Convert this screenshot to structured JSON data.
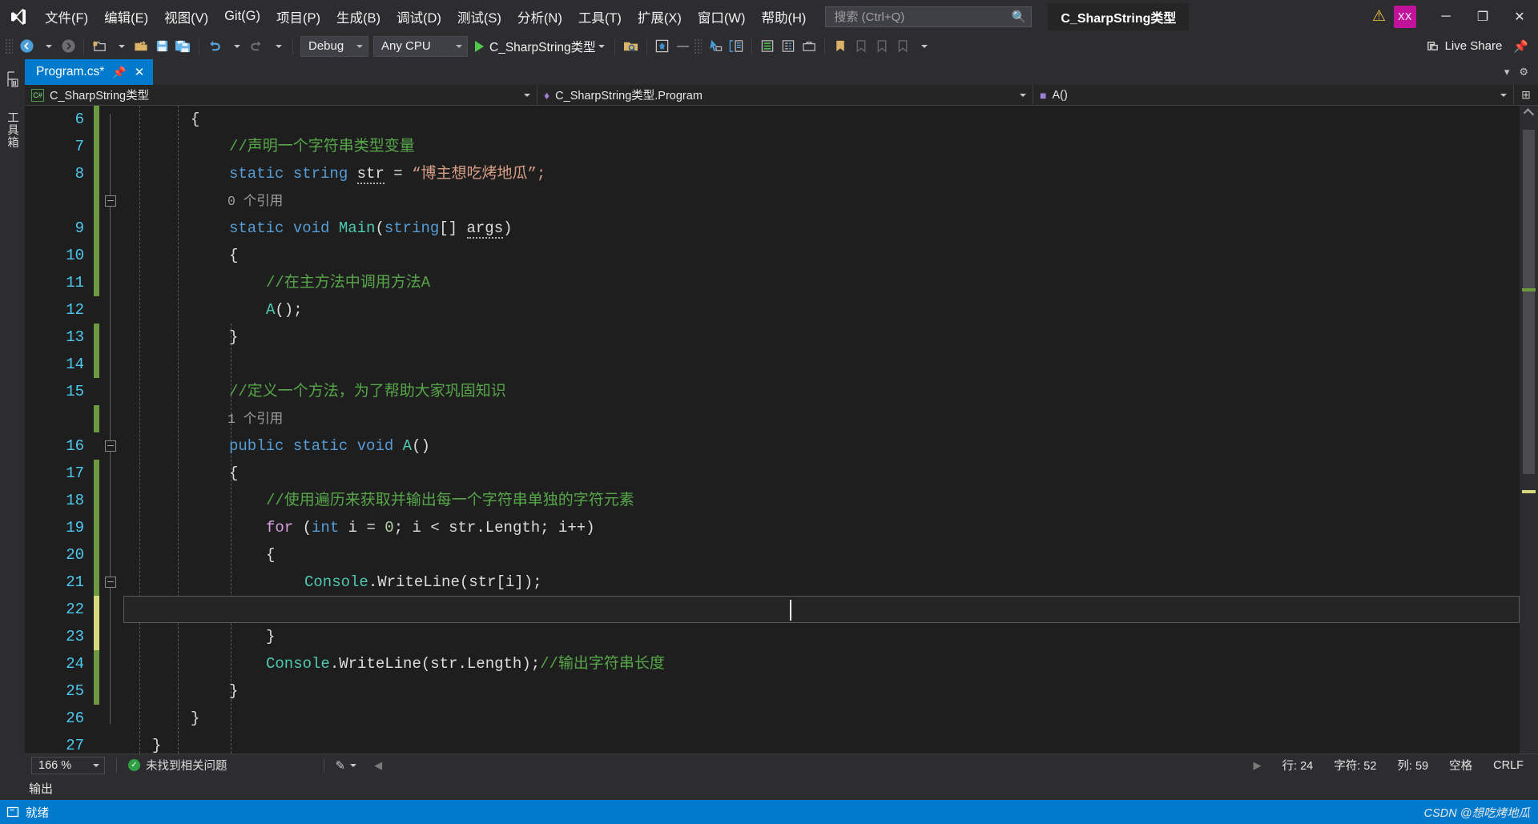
{
  "titlebar": {
    "logo_icon": "visual-studio-logo-icon",
    "menus": [
      {
        "label": "文件(F)",
        "accel": "F"
      },
      {
        "label": "编辑(E)",
        "accel": "E"
      },
      {
        "label": "视图(V)",
        "accel": "V"
      },
      {
        "label": "Git(G)",
        "accel": "G"
      },
      {
        "label": "项目(P)",
        "accel": "P"
      },
      {
        "label": "生成(B)",
        "accel": "B"
      },
      {
        "label": "调试(D)",
        "accel": "D"
      },
      {
        "label": "测试(S)",
        "accel": "S"
      },
      {
        "label": "分析(N)",
        "accel": "N"
      },
      {
        "label": "工具(T)",
        "accel": "T"
      },
      {
        "label": "扩展(X)",
        "accel": "X"
      },
      {
        "label": "窗口(W)",
        "accel": "W"
      },
      {
        "label": "帮助(H)",
        "accel": "H"
      }
    ],
    "search": {
      "placeholder": "搜索 (Ctrl+Q)",
      "value": "",
      "icon": "search-icon"
    },
    "project_name": "C_SharpString类型",
    "warning_icon": "warning-triangle-icon",
    "avatar_initials": "XX",
    "avatar_color": "#c1129a",
    "window_buttons": {
      "minimize": "─",
      "maximize": "❐",
      "close": "✕"
    }
  },
  "toolbar": {
    "nav_back_icon": "navigate-back-icon",
    "nav_forward_icon": "navigate-forward-icon",
    "new_project_icon": "new-project-icon",
    "open_icon": "open-file-icon",
    "save_icon": "save-icon",
    "save_all_icon": "save-all-icon",
    "undo_icon": "undo-icon",
    "redo_icon": "redo-icon",
    "config_value": "Debug",
    "platform_value": "Any CPU",
    "run_label": "C_SharpString类型",
    "run_icon": "play-icon",
    "find_in_files_icon": "find-in-files-icon",
    "home_icon": "home-window-icon",
    "pointer_icon": "pointer-select-icon",
    "compare_icon": "compare-files-icon",
    "properties_icon": "properties-icon",
    "solution_explorer_icon": "solution-explorer-icon",
    "toolbox_icon": "toolbox-icon",
    "bookmark_icon": "bookmark-icon",
    "live_share_label": "Live Share",
    "live_share_icon": "live-share-icon",
    "pin_icon": "pin-icon"
  },
  "leftrail": {
    "toolbox_label": "工具箱"
  },
  "tabs": {
    "active": {
      "label": "Program.cs*",
      "pin_icon": "pin-icon",
      "close_icon": "close-icon"
    },
    "right_icons": [
      "chevron-down-icon",
      "gear-icon"
    ]
  },
  "navbar": {
    "project": "C_SharpString类型",
    "project_icon": "csharp-file-icon",
    "class": "C_SharpString类型.Program",
    "class_icon": "class-icon",
    "member": "A()",
    "member_icon": "method-icon",
    "expand_icon": "expand-icon"
  },
  "editor": {
    "first_line": 6,
    "lines": [
      {
        "n": 6,
        "indent": 2,
        "html_key": "l6"
      },
      {
        "n": 7,
        "indent": 3,
        "html_key": "l7"
      },
      {
        "n": 8,
        "indent": 3,
        "html_key": "l8"
      },
      {
        "n": "",
        "indent": 3,
        "html_key": "ref0"
      },
      {
        "n": 9,
        "indent": 3,
        "html_key": "l9"
      },
      {
        "n": 10,
        "indent": 3,
        "html_key": "l10"
      },
      {
        "n": 11,
        "indent": 4,
        "html_key": "l11"
      },
      {
        "n": 12,
        "indent": 4,
        "html_key": "l12"
      },
      {
        "n": 13,
        "indent": 3,
        "html_key": "l13"
      },
      {
        "n": 14,
        "indent": 0,
        "html_key": "l14"
      },
      {
        "n": 15,
        "indent": 3,
        "html_key": "l15"
      },
      {
        "n": "",
        "indent": 3,
        "html_key": "ref1"
      },
      {
        "n": 16,
        "indent": 3,
        "html_key": "l16"
      },
      {
        "n": 17,
        "indent": 3,
        "html_key": "l17"
      },
      {
        "n": 18,
        "indent": 4,
        "html_key": "l18"
      },
      {
        "n": 19,
        "indent": 4,
        "html_key": "l19"
      },
      {
        "n": 20,
        "indent": 4,
        "html_key": "l20"
      },
      {
        "n": 21,
        "indent": 5,
        "html_key": "l21"
      },
      {
        "n": 22,
        "indent": 5,
        "html_key": "l22"
      },
      {
        "n": 23,
        "indent": 4,
        "html_key": "l23"
      },
      {
        "n": 24,
        "indent": 4,
        "html_key": "l24"
      },
      {
        "n": 25,
        "indent": 3,
        "html_key": "l25"
      },
      {
        "n": 26,
        "indent": 2,
        "html_key": "l26"
      },
      {
        "n": 27,
        "indent": 1,
        "html_key": "l27"
      }
    ],
    "text": {
      "l6": "{",
      "l7": "//声明一个字符串类型变量",
      "l8": "static string str = \"博主想吃烤地瓜\";",
      "ref0": "0 个引用",
      "l9": "static void Main(string[] args)",
      "l10": "{",
      "l11": "//在主方法中调用方法A",
      "l12": "A();",
      "l13": "}",
      "l14": "",
      "l15": "//定义一个方法，为了帮助大家巩固知识",
      "ref1": "1 个引用",
      "l16": "public static void A()",
      "l17": "{",
      "l18": "//使用遍历来获取并输出每一个字符串单独的字符元素",
      "l19": "for (int i = 0; i < str.Length; i++)",
      "l20": "{",
      "l21": "Console.WriteLine(str[i]);",
      "l22": "",
      "l23": "}",
      "l24": "Console.WriteLine(str.Length);//输出字符串长度",
      "l25": "}",
      "l26": "}",
      "l27": "}"
    },
    "current_line": 24,
    "colors": {
      "keyword": "#569cd6",
      "control": "#d8a0df",
      "type": "#4ec9b0",
      "string": "#d69d85",
      "comment": "#57a64a",
      "number": "#b5cea8",
      "identifier": "#dcdcdc",
      "linenumber": "#4ec9f0",
      "background": "#1e1e1e"
    }
  },
  "statusbar": {
    "zoom": "166 %",
    "issues_icon": "check-circle-icon",
    "issues_label": "未找到相关问题",
    "pen_icon": "pen-icon",
    "prev_icon": "chevron-left-icon",
    "next_icon": "chevron-right-icon",
    "line_label": "行:",
    "line_value": "24",
    "char_label": "字符:",
    "char_value": "52",
    "col_label": "列:",
    "col_value": "59",
    "spaces": "空格",
    "eol": "CRLF"
  },
  "output": {
    "label": "输出"
  },
  "bottombar": {
    "ready_icon": "ready-icon",
    "ready_label": "就绪",
    "watermark": "CSDN @想吃烤地瓜"
  }
}
